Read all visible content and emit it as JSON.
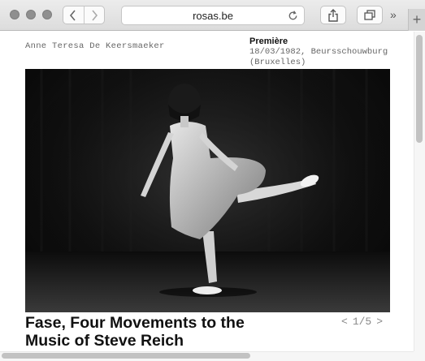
{
  "browser": {
    "url": "rosas.be",
    "icons": {
      "back": "chevron-left-icon",
      "forward": "chevron-right-icon",
      "reload": "reload-icon",
      "share": "share-icon",
      "tabs": "tabs-icon",
      "overflow": "double-chevron-icon",
      "new_tab": "plus-icon"
    },
    "overflow_glyph": "»",
    "new_tab_glyph": "+"
  },
  "header": {
    "author": "Anne Teresa De Keersmaeker",
    "premiere_label": "Première",
    "premiere_line1": "18/03/1982, Beursschouwburg",
    "premiere_line2": "(Bruxelles)"
  },
  "main": {
    "title": "Fase, Four Movements to the Music of Steve Reich",
    "pager": {
      "prev": "<",
      "current": "1/5",
      "next": ">"
    }
  },
  "colors": {
    "toolbar": "#dcdcdc",
    "text": "#111111",
    "muted": "#666666"
  }
}
